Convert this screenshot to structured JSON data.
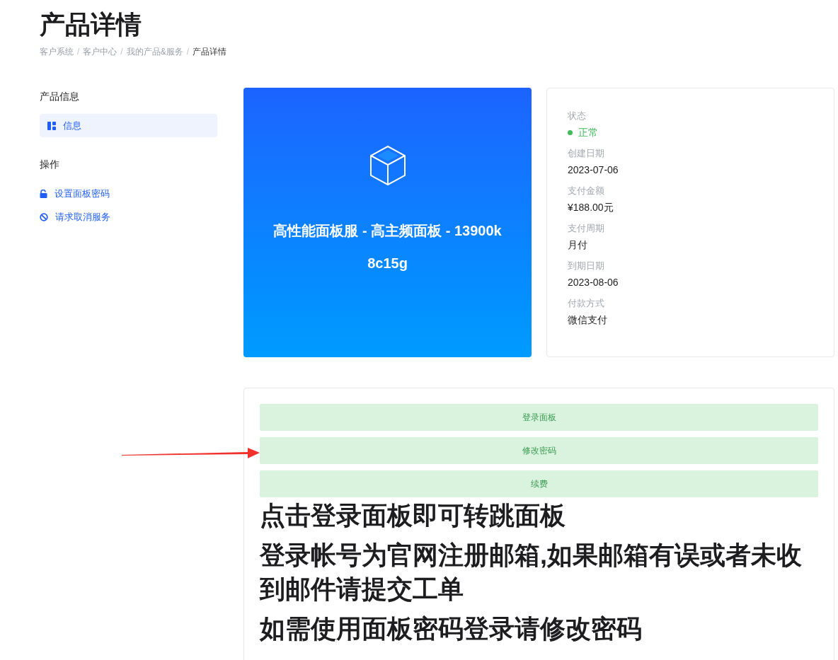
{
  "page_title": "产品详情",
  "breadcrumb_separator": "/",
  "breadcrumb": [
    {
      "label": "客户系统",
      "selected": false
    },
    {
      "label": "客户中心",
      "selected": false
    },
    {
      "label": "我的产品&服务",
      "selected": false
    },
    {
      "label": "产品详情",
      "selected": true
    }
  ],
  "sidebar": {
    "sections": [
      {
        "title": "产品信息",
        "items": [
          {
            "label": "信息",
            "kind": "nav",
            "selected": true
          }
        ]
      },
      {
        "title": "操作",
        "items": [
          {
            "label": "设置面板密码",
            "kind": "lock",
            "selected": false
          },
          {
            "label": "请求取消服务",
            "kind": "ban",
            "selected": false
          }
        ]
      }
    ]
  },
  "product": {
    "name": "高性能面板服 - 高主频面板 - 13900k 8c15g"
  },
  "details": [
    {
      "label": "状态",
      "value": "正常",
      "kind": "status"
    },
    {
      "label": "创建日期",
      "value": "2023-07-06",
      "kind": "text"
    },
    {
      "label": "支付金额",
      "value": "¥188.00元",
      "kind": "text"
    },
    {
      "label": "支付周期",
      "value": "月付",
      "kind": "text"
    },
    {
      "label": "到期日期",
      "value": "2023-08-06",
      "kind": "text"
    },
    {
      "label": "付款方式",
      "value": "微信支付",
      "kind": "text"
    }
  ],
  "actions": [
    "登录面板",
    "修改密码",
    "续费"
  ],
  "notes": [
    "点击登录面板即可转跳面板",
    "登录帐号为官网注册邮箱,如果邮箱有误或者未收到邮件请提交工单",
    "如需使用面板密码登录请修改密码"
  ]
}
